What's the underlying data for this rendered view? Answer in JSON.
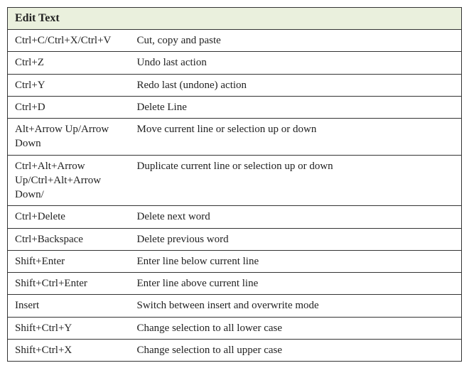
{
  "table": {
    "title": "Edit Text",
    "rows": [
      {
        "shortcut": "Ctrl+C/Ctrl+X/Ctrl+V",
        "description": "Cut, copy and paste"
      },
      {
        "shortcut": "Ctrl+Z",
        "description": "Undo last action"
      },
      {
        "shortcut": "Ctrl+Y",
        "description": "Redo last (undone) action"
      },
      {
        "shortcut": "Ctrl+D",
        "description": "Delete Line"
      },
      {
        "shortcut": "Alt+Arrow Up/Arrow Down",
        "description": "Move current line or selection up or down"
      },
      {
        "shortcut": "Ctrl+Alt+Arrow Up/Ctrl+Alt+Arrow Down/",
        "description": "Duplicate current line or selection up or down"
      },
      {
        "shortcut": "Ctrl+Delete",
        "description": "Delete next word"
      },
      {
        "shortcut": "Ctrl+Backspace",
        "description": "Delete previous word"
      },
      {
        "shortcut": "Shift+Enter",
        "description": "Enter line below current line"
      },
      {
        "shortcut": "Shift+Ctrl+Enter",
        "description": "Enter line above current line"
      },
      {
        "shortcut": "Insert",
        "description": "Switch between insert and overwrite mode"
      },
      {
        "shortcut": "Shift+Ctrl+Y",
        "description": "Change selection to all lower case"
      },
      {
        "shortcut": "Shift+Ctrl+X",
        "description": "Change selection to all upper case"
      }
    ]
  }
}
